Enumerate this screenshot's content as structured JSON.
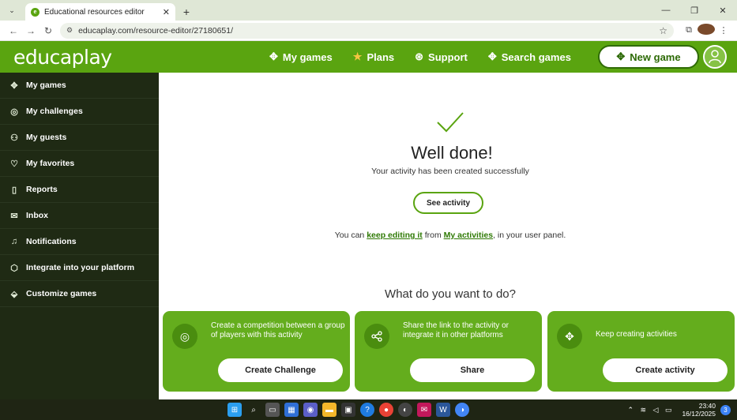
{
  "browser": {
    "tab_title": "Educational resources editor",
    "url": "educaplay.com/resource-editor/27180651/",
    "new_tab_symbol": "+",
    "close_symbol": "✕",
    "accent_color": "#dfe7d6"
  },
  "header": {
    "logo": "educaplay",
    "nav": [
      {
        "label": "My games",
        "icon": "puzzle-icon"
      },
      {
        "label": "Plans",
        "icon": "star-icon"
      },
      {
        "label": "Support",
        "icon": "lifebuoy-icon"
      },
      {
        "label": "Search games",
        "icon": "search-puzzle-icon"
      }
    ],
    "new_game_label": "New game",
    "brand_color": "#5aa410"
  },
  "sidebar": {
    "items": [
      {
        "label": "My games",
        "icon": "puzzle-icon"
      },
      {
        "label": "My challenges",
        "icon": "target-icon"
      },
      {
        "label": "My guests",
        "icon": "people-icon"
      },
      {
        "label": "My favorites",
        "icon": "heart-icon"
      },
      {
        "label": "Reports",
        "icon": "clipboard-icon"
      },
      {
        "label": "Inbox",
        "icon": "mail-icon"
      },
      {
        "label": "Notifications",
        "icon": "bell-icon"
      },
      {
        "label": "Integrate into your platform",
        "icon": "cube-icon"
      },
      {
        "label": "Customize games",
        "icon": "paint-bucket-icon"
      }
    ]
  },
  "main": {
    "title": "Well done!",
    "subtitle": "Your activity has been created successfully",
    "see_activity_label": "See activity",
    "edit_prefix": "You can ",
    "edit_link": "keep editing it",
    "edit_middle": " from ",
    "activities_link": "My activities",
    "edit_suffix": ", in your user panel.",
    "question": "What do you want to do?",
    "cards": [
      {
        "text": "Create a competition between a group of players with this activity",
        "button": "Create Challenge",
        "icon": "target-icon"
      },
      {
        "text": "Share the link to the activity or integrate it in other platforms",
        "button": "Share",
        "icon": "share-icon"
      },
      {
        "text": "Keep creating activities",
        "button": "Create activity",
        "icon": "puzzle-icon"
      }
    ]
  },
  "taskbar": {
    "time": "23:40",
    "date": "16/12/2025",
    "notification_count": "3"
  }
}
